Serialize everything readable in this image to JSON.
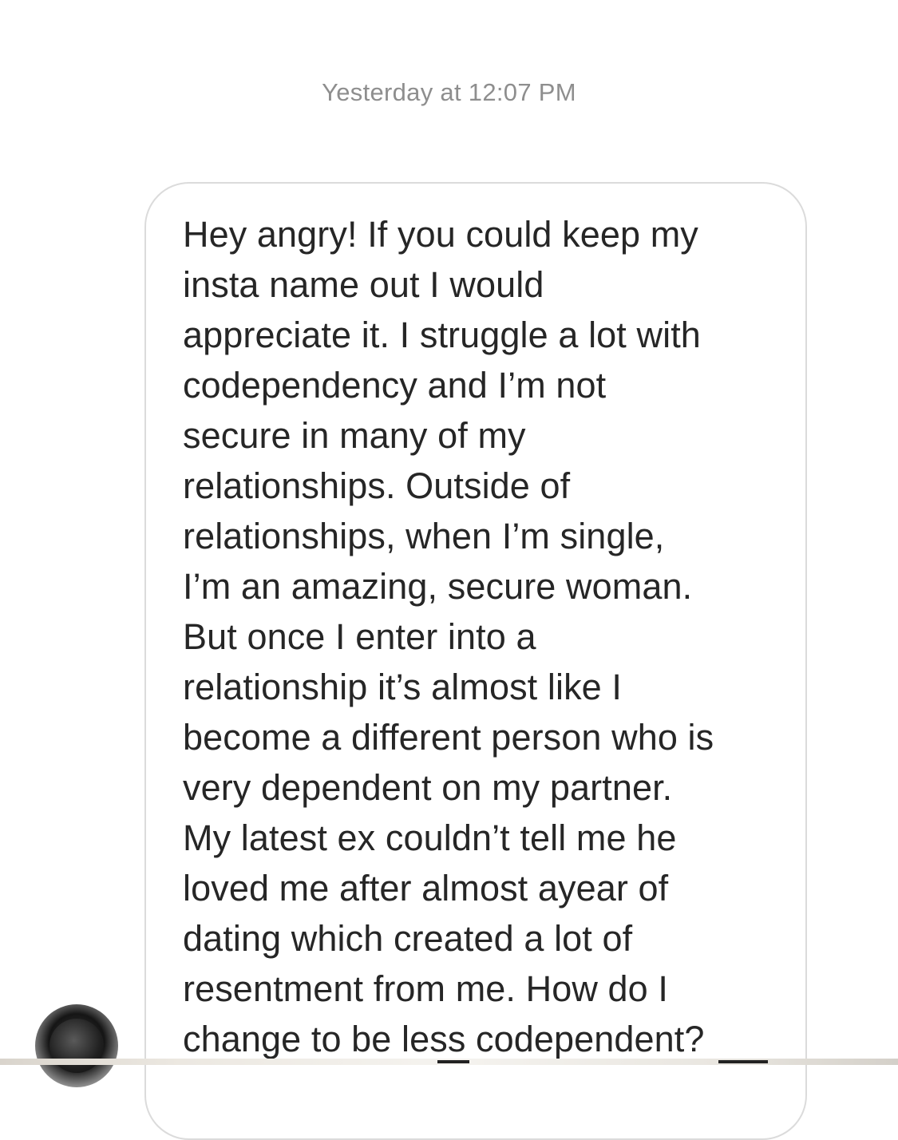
{
  "conversation": {
    "timestamp": "Yesterday at 12:07 PM",
    "message_lines": [
      "Hey angry! If you could keep my",
      "insta name out I would",
      "appreciate it. I struggle a lot with",
      "codependency and I’m not",
      "secure in many of my",
      "relationships. Outside of",
      "relationships, when I’m single,",
      "I’m an amazing, secure woman.",
      "But once I enter into a",
      "relationship it’s almost like I",
      "become a different person who is",
      "very dependent on my partner.",
      "My latest ex couldn’t tell me he",
      "loved me after almost ayear of",
      "dating which created a lot of",
      "resentment from me. How do I",
      "change to be less codependent?"
    ]
  },
  "colors": {
    "text": "#262626",
    "timestamp": "#8e8e8e",
    "bubble_border": "#dbdbdb",
    "background": "#ffffff"
  },
  "icons": {
    "avatar": "sender-avatar"
  }
}
